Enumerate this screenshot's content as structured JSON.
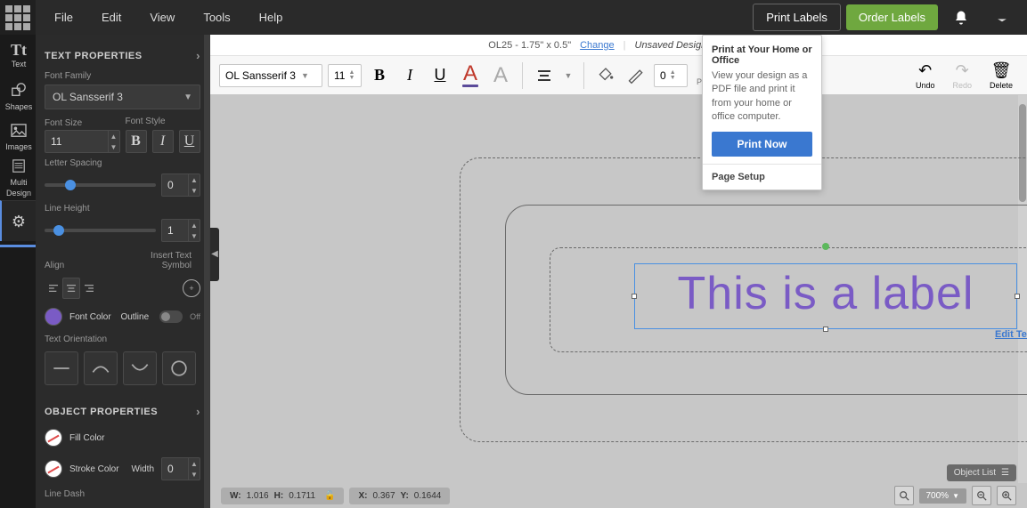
{
  "menu": {
    "file": "File",
    "edit": "Edit",
    "view": "View",
    "tools": "Tools",
    "help": "Help"
  },
  "buttons": {
    "print": "Print Labels",
    "order": "Order Labels"
  },
  "rail": {
    "text": "Text",
    "shapes": "Shapes",
    "images": "Images",
    "multi1": "Multi",
    "multi2": "Design"
  },
  "panel": {
    "text_header": "TEXT PROPERTIES",
    "font_family": "Font Family",
    "font_family_val": "OL Sansserif 3",
    "font_size": "Font Size",
    "font_size_val": "11",
    "font_style": "Font Style",
    "letter_spacing": "Letter Spacing",
    "letter_spacing_val": "0",
    "line_height": "Line Height",
    "line_height_val": "1",
    "align": "Align",
    "insert_sym": "Insert Text Symbol",
    "font_color": "Font Color",
    "outline": "Outline",
    "outline_state": "Off",
    "orientation": "Text Orientation",
    "object_header": "OBJECT PROPERTIES",
    "fill_color": "Fill Color",
    "stroke_color": "Stroke Color",
    "width": "Width",
    "width_val": "0",
    "line_dash": "Line Dash"
  },
  "dochdr": {
    "code": "OL25 - 1.75\" x 0.5\"",
    "change": "Change",
    "unsaved": "Unsaved Design*"
  },
  "toolbar": {
    "font": "OL Sansserif 3",
    "size": "11",
    "rot_val": "0",
    "position": "Position",
    "undo": "Undo",
    "redo": "Redo",
    "delete": "Delete"
  },
  "popover": {
    "title": "Print at Your Home or Office",
    "body": "View your design as a PDF file and print it from your home or office computer.",
    "btn": "Print Now",
    "foot": "Page Setup"
  },
  "canvas": {
    "text": "This is a label",
    "edit": "Edit Text"
  },
  "status": {
    "w": "W:",
    "w_v": "1.016",
    "h": "H:",
    "h_v": "0.1711",
    "x": "X:",
    "x_v": "0.367",
    "y": "Y:",
    "y_v": "0.1644",
    "zoom": "700%",
    "objlist": "Object List"
  }
}
